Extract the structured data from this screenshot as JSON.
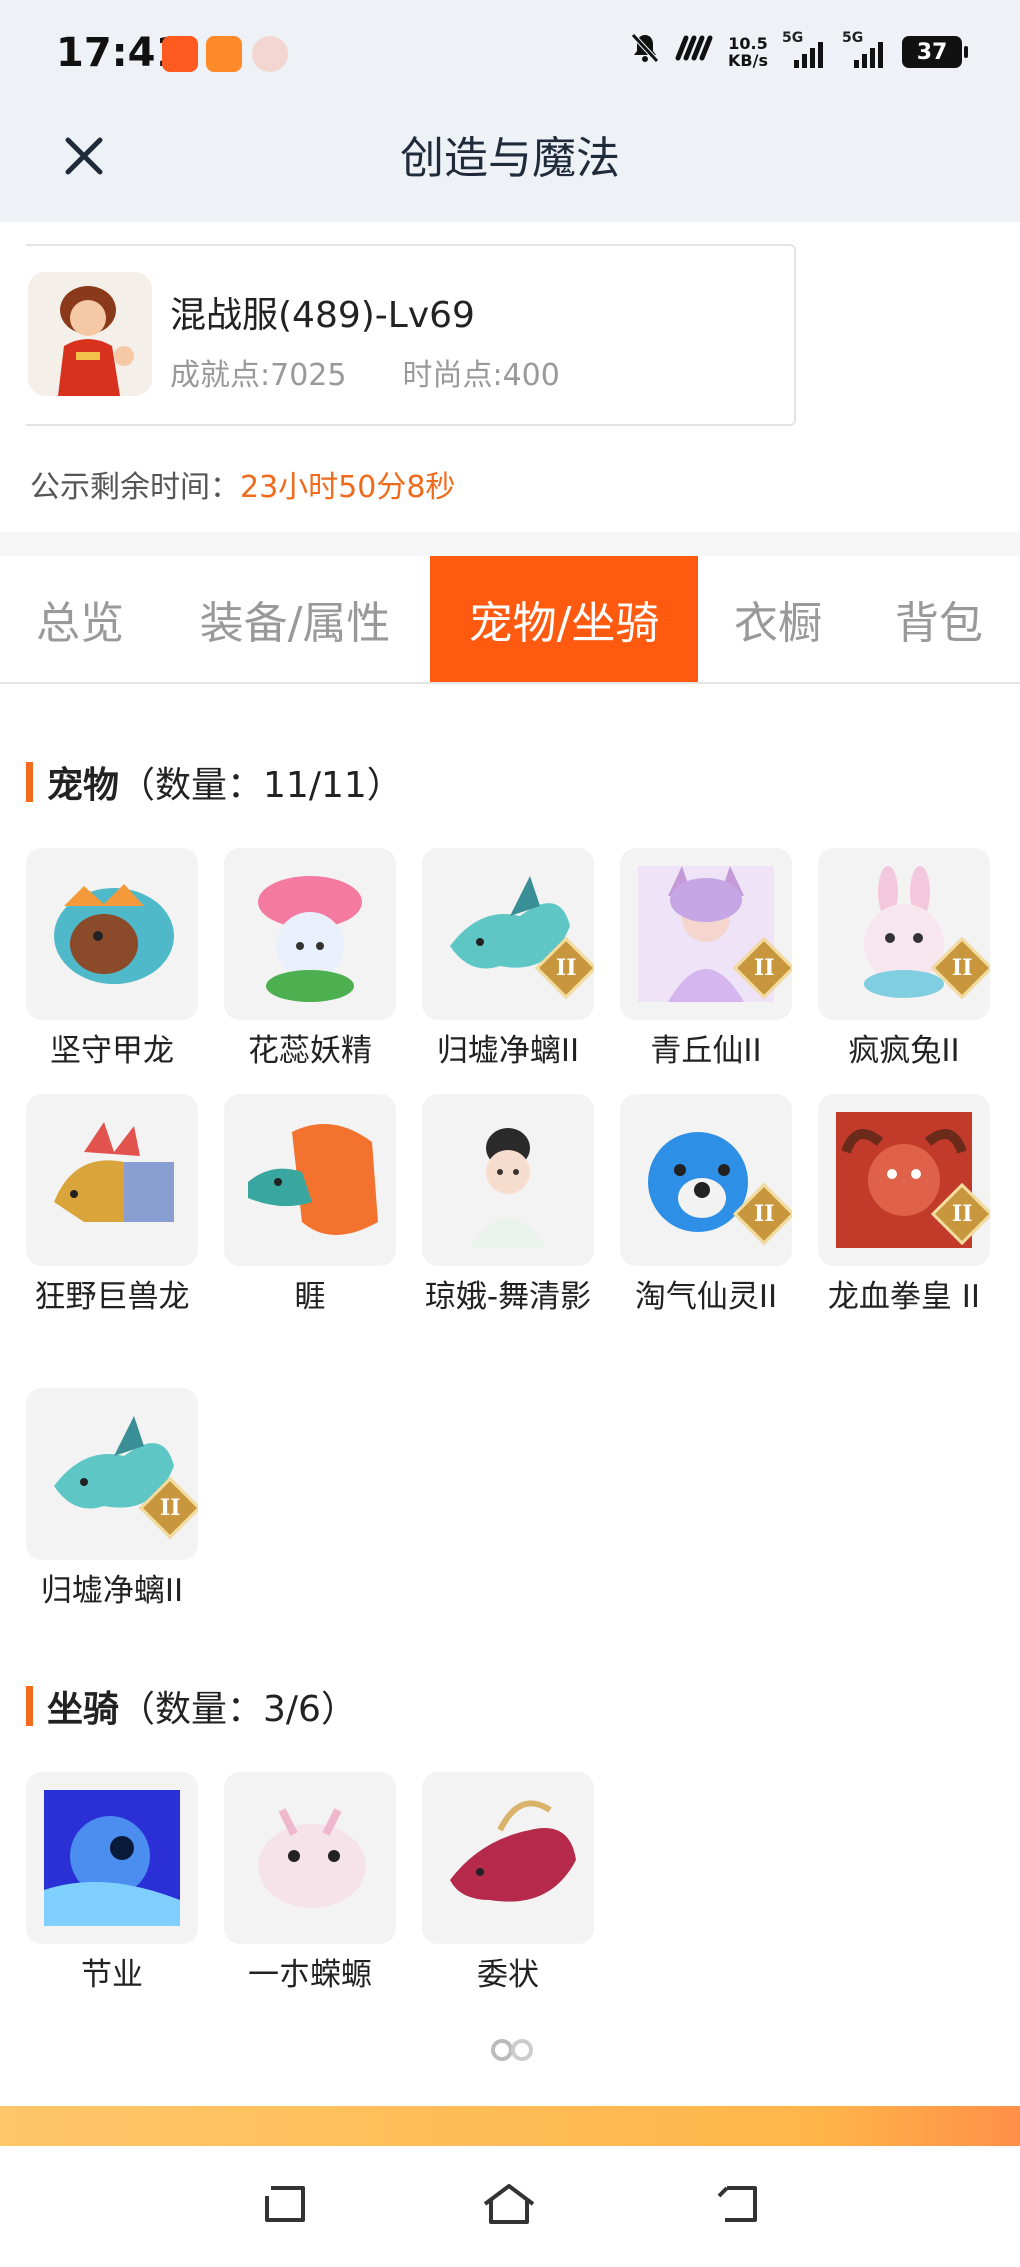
{
  "status_bar": {
    "time": "17:41",
    "net_speed_value": "10.5",
    "net_speed_unit": "KB/s",
    "signal1_label": "5G",
    "signal2_label": "5G",
    "battery": "37",
    "icons": [
      "kuaishou-app-icon",
      "video-app-icon",
      "avatar-app-icon",
      "mute-bell-icon",
      "nfc-icon"
    ]
  },
  "header": {
    "title": "创造与魔法",
    "close_icon": "close-icon"
  },
  "character": {
    "name": "混战服(489)-Lv69",
    "achievement": "成就点:7025",
    "fashion": "时尚点:400"
  },
  "countdown": {
    "label": "公示剩余时间：",
    "value": "23小时50分8秒"
  },
  "tabs": [
    {
      "label": "总览",
      "active": false
    },
    {
      "label": "装备/属性",
      "active": false
    },
    {
      "label": "宠物/坐骑",
      "active": true
    },
    {
      "label": "衣橱",
      "active": false
    },
    {
      "label": "背包",
      "active": false
    }
  ],
  "pets": {
    "title": "宠物",
    "count": "（数量：11/11）",
    "items": [
      {
        "name": "坚守甲龙",
        "badge": ""
      },
      {
        "name": "花蕊妖精",
        "badge": ""
      },
      {
        "name": "归墟净螭II",
        "badge": "II"
      },
      {
        "name": "青丘仙II",
        "badge": "II"
      },
      {
        "name": "疯疯兔II",
        "badge": "II"
      },
      {
        "name": "狂野巨兽龙",
        "badge": ""
      },
      {
        "name": "睚",
        "badge": ""
      },
      {
        "name": "琼娥-舞清影",
        "badge": ""
      },
      {
        "name": "淘气仙灵II",
        "badge": "II"
      },
      {
        "name": "龙血拳皇 II",
        "badge": "II"
      },
      {
        "name": "归墟净螭II",
        "badge": "II"
      }
    ]
  },
  "mounts": {
    "title": "坐骑",
    "count": "（数量：3/6）",
    "items": [
      {
        "name": "节业"
      },
      {
        "name": "一朩蝾螈"
      },
      {
        "name": "委状"
      }
    ]
  },
  "colors": {
    "accent": "#ff5a10",
    "countdown": "#f06a1c",
    "header_bg": "#eef2f6"
  },
  "nav_bar": [
    "recent-apps-icon",
    "home-icon",
    "back-icon"
  ]
}
